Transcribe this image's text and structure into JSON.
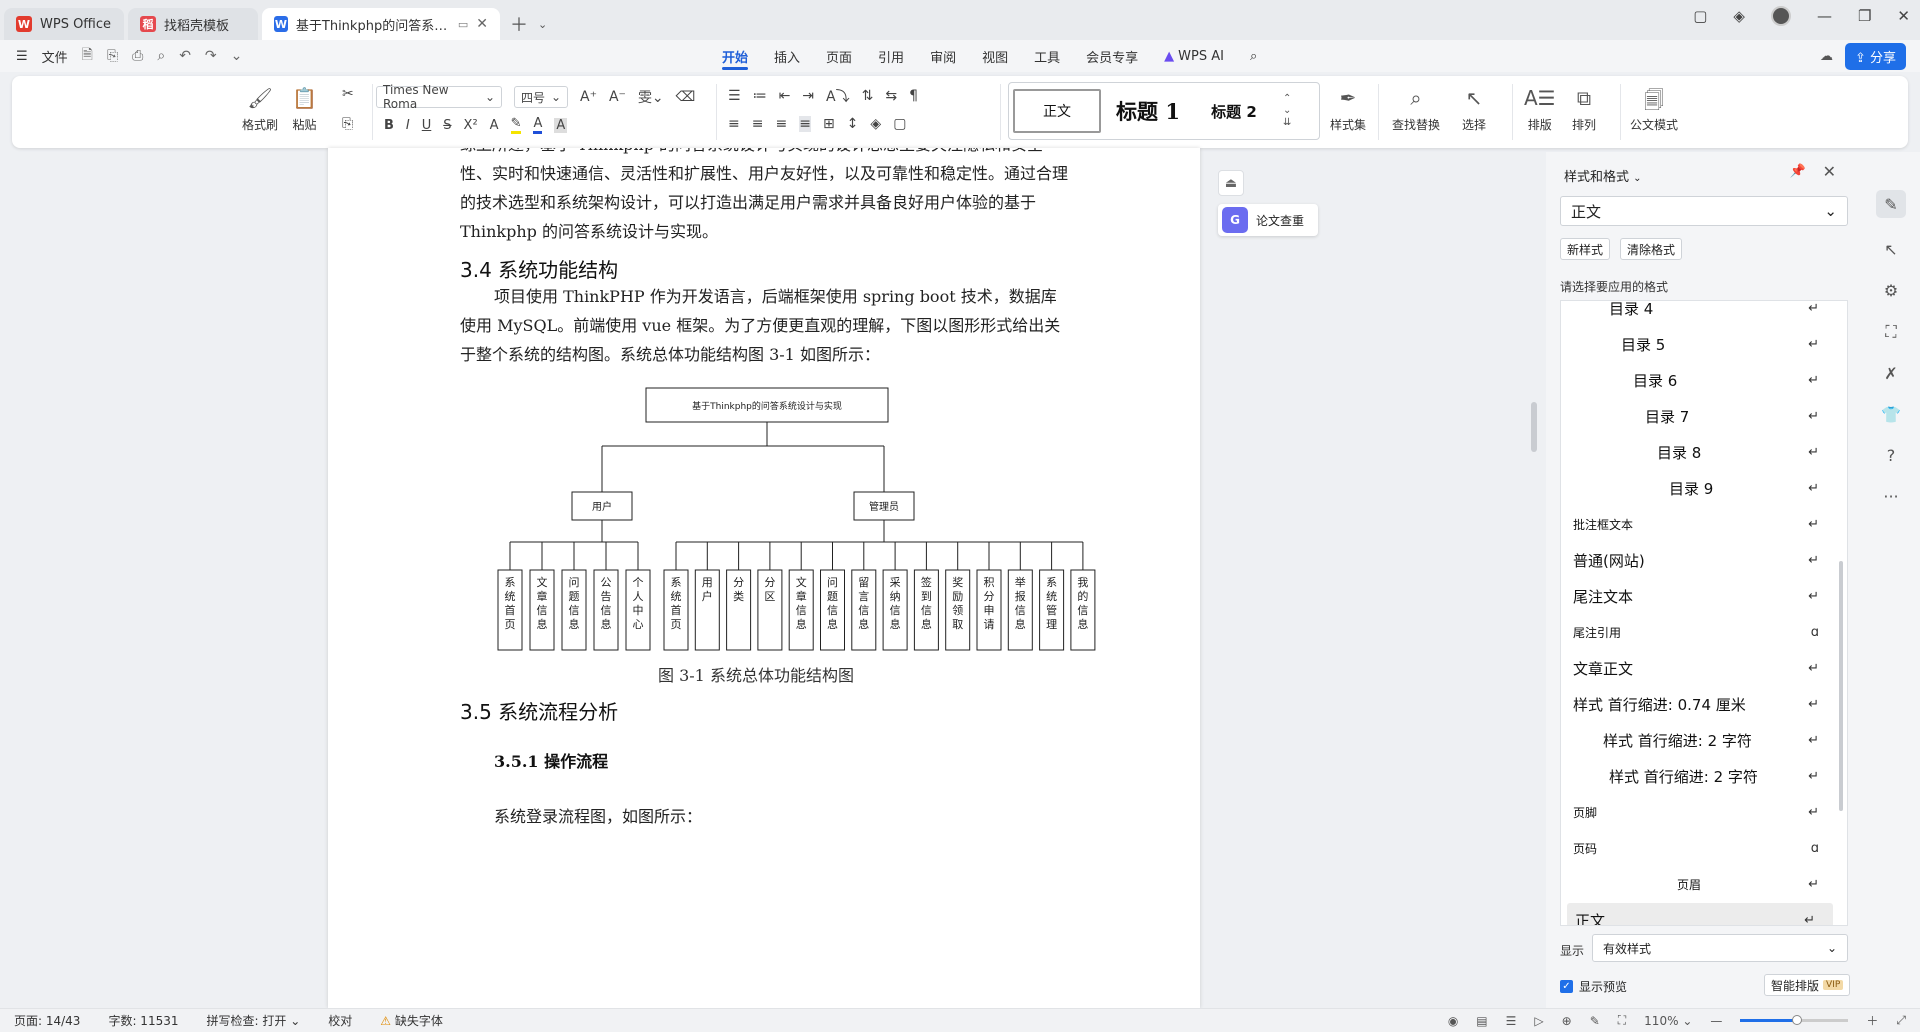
{
  "tabs": [
    {
      "label": "WPS Office",
      "icon": "wps-logo-icon"
    },
    {
      "label": "找稻壳模板",
      "icon": "docer-icon"
    },
    {
      "label": "基于Thinkphp的问答系统设计",
      "icon": "writer-doc-icon"
    }
  ],
  "menu": {
    "file": "文件",
    "tabs": [
      "开始",
      "插入",
      "页面",
      "引用",
      "审阅",
      "视图",
      "工具",
      "会员专享"
    ],
    "active_tab": "开始",
    "ai": "WPS AI",
    "share": "分享"
  },
  "ribbon": {
    "format_painter": "格式刷",
    "paste": "粘贴",
    "font_name": "Times New Roma",
    "font_size": "四号",
    "styles": {
      "normal": "正文",
      "h1": "标题 1",
      "h2": "标题 2"
    },
    "style_set": "样式集",
    "find_replace": "查找替换",
    "select": "选择",
    "layout": "排版",
    "arrange": "排列",
    "doc_format": "公文模式"
  },
  "document": {
    "para1": "综上所述，基于 Thinkphp 的问答系统设计与实现的设计思想主要关注隐私和安全性、实时和快速通信、灵活性和扩展性、用户友好性，以及可靠性和稳定性。通过合理的技术选型和系统架构设计，可以打造出满足用户需求并具备良好用户体验的基于 Thinkphp 的问答系统设计与实现。",
    "h34": "3.4 系统功能结构",
    "para2": "项目使用 ThinkPHP 作为开发语言，后端框架使用 spring boot 技术，数据库使用 MySQL。前端使用 vue 框架。为了方便更直观的理解，下图以图形形式给出关于整个系统的结构图。系统总体功能结构图 3-1 如图所示：",
    "diagram": {
      "root": "基于Thinkphp的问答系统设计与实现",
      "user": "用户",
      "admin": "管理员",
      "user_children": [
        "系统首页",
        "文章信息",
        "问题信息",
        "公告信息",
        "个人中心"
      ],
      "admin_children": [
        "系统首页",
        "用户",
        "分类",
        "分区",
        "文章信息",
        "问题信息",
        "留言信息",
        "采纳信息",
        "签到信息",
        "奖励领取",
        "积分申请",
        "举报信息",
        "系统管理",
        "我的信息"
      ]
    },
    "caption": "图 3-1 系统总体功能结构图",
    "h35": "3.5 系统流程分析",
    "h351": "3.5.1 操作流程",
    "para3": "系统登录流程图，如图所示："
  },
  "float": {
    "check": "论文查重"
  },
  "style_panel": {
    "title": "样式和格式",
    "current": "正文",
    "new_style": "新样式",
    "clear_format": "清除格式",
    "hint": "请选择要应用的格式",
    "items": [
      {
        "label": "目录 4"
      },
      {
        "label": "目录 5"
      },
      {
        "label": "目录 6"
      },
      {
        "label": "目录 7"
      },
      {
        "label": "目录 8"
      },
      {
        "label": "目录 9"
      },
      {
        "label": "批注框文本"
      },
      {
        "label": "普通(网站)"
      },
      {
        "label": "尾注文本"
      },
      {
        "label": "尾注引用"
      },
      {
        "label": "文章正文"
      },
      {
        "label": "样式 首行缩进:   0.74 厘米"
      },
      {
        "label": "样式 首行缩进:   2 字符"
      },
      {
        "label": "样式 首行缩进: 2 字符"
      },
      {
        "label": "页脚"
      },
      {
        "label": "页码"
      },
      {
        "label": "页眉"
      },
      {
        "label": "正文"
      }
    ],
    "show_label": "显示",
    "show_value": "有效样式",
    "show_preview": "显示预览",
    "smart_layout": "智能排版",
    "vip": "VIP"
  },
  "status": {
    "page": "页面: 14/43",
    "words": "字数: 11531",
    "spell": "拼写检查: 打开",
    "proof": "校对",
    "missing_font": "缺失字体",
    "zoom": "110%",
    "zoom_level": 0.52
  }
}
